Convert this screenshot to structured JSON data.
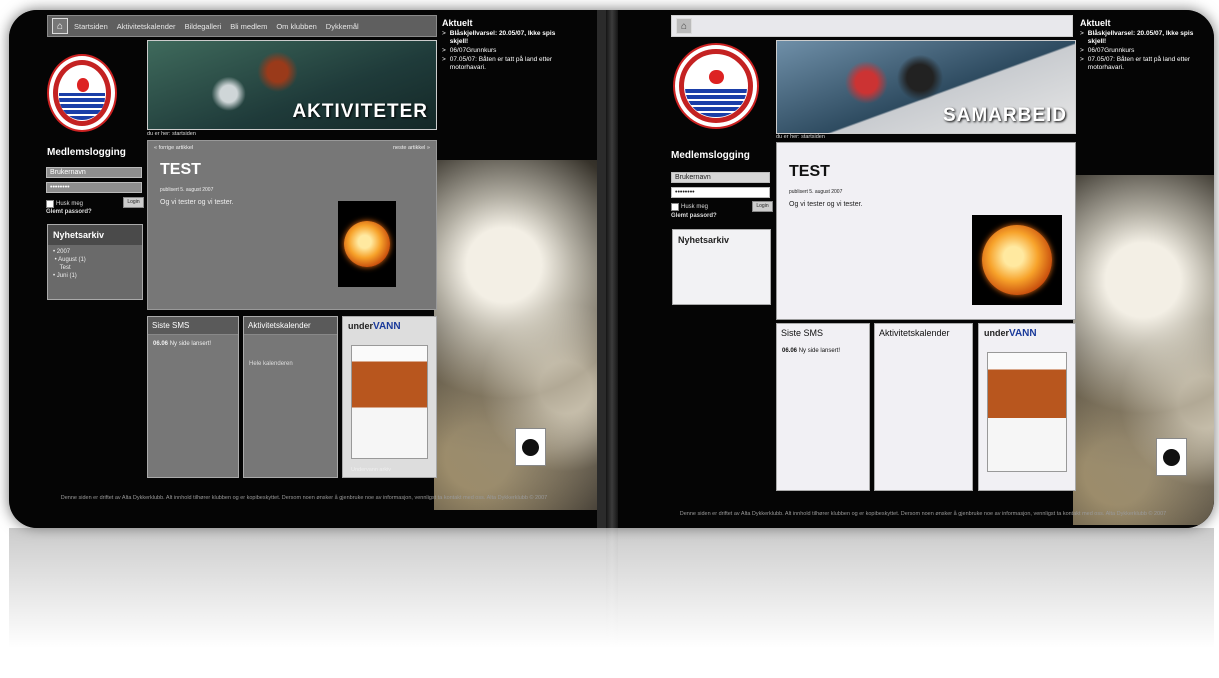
{
  "nav": [
    "Startsiden",
    "Aktivitetskalender",
    "Bildegalleri",
    "Bli medlem",
    "Om klubben",
    "Dykkemål"
  ],
  "left": {
    "banner_text": "AKTIVITETER"
  },
  "right": {
    "banner_text": "SAMARBEID"
  },
  "breadcrumb": "du er her: startsiden",
  "login": {
    "title": "Medlemslogging",
    "username_placeholder": "Brukernavn",
    "password_value": "••••••••",
    "remember": "Husk meg",
    "button": "Login",
    "forgot": "Glemt passord?"
  },
  "archive": {
    "title": "Nyhetsarkiv",
    "year": "2007",
    "month1": "August (1)",
    "item": "Test",
    "month2": "Juni (1)"
  },
  "article": {
    "prev": "« forrige artikkel",
    "next": "neste artikkel »",
    "title": "TEST",
    "date": "publisert 5. august 2007",
    "body": "Og vi tester og vi tester."
  },
  "sms": {
    "title": "Siste SMS",
    "date": "06.06",
    "text": "Ny side lansert!"
  },
  "calendar": {
    "title": "Aktivitetskalender",
    "link": "Hele kalenderen"
  },
  "magazine": {
    "name_a": "under",
    "name_b": "VANN",
    "link": "Undervann arkiv"
  },
  "aktuelt": {
    "title": "Aktuelt",
    "items": [
      "Blåskjellvarsel: 20.05/07, Ikke spis skjell!",
      "06/07Grunnkurs",
      "07.05/07: Båten er tatt på land etter motorhavari."
    ]
  },
  "footer": "Denne siden er driftet av Alta Dykkerklubb. Alt innhold tilhører klubben og er kopibeskyttet. Dersom noen ønsker å gjenbruke noe av informasjon, vennligst ta kontakt med oss. Alta Dykkerklubb © 2007"
}
